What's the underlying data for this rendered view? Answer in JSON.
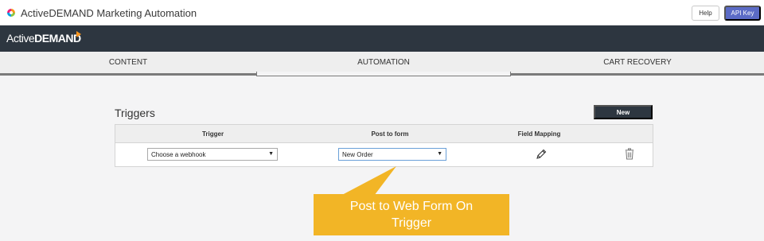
{
  "header": {
    "app_title": "ActiveDEMAND Marketing Automation",
    "help_label": "Help",
    "api_key_label": "API Key"
  },
  "brand": {
    "logo_text_light": "Active",
    "logo_text_bold": "DEMAND"
  },
  "tabs": [
    {
      "label": "CONTENT",
      "active": false
    },
    {
      "label": "AUTOMATION",
      "active": true
    },
    {
      "label": "CART RECOVERY",
      "active": false
    }
  ],
  "triggers": {
    "heading": "Triggers",
    "new_button_label": "New",
    "columns": [
      "Trigger",
      "Post to form",
      "Field Mapping"
    ],
    "rows": [
      {
        "trigger_value": "Choose a webhook",
        "post_to_form_value": "New Order",
        "field_mapping_icon": "pencil-icon",
        "delete_icon": "trash-icon"
      }
    ]
  },
  "callout": {
    "text": "Post to Web Form On Trigger"
  },
  "colors": {
    "brand_bar": "#2d3640",
    "api_key_button": "#5b6bc6",
    "callout": "#f2b526",
    "new_button": "#2d3640"
  }
}
